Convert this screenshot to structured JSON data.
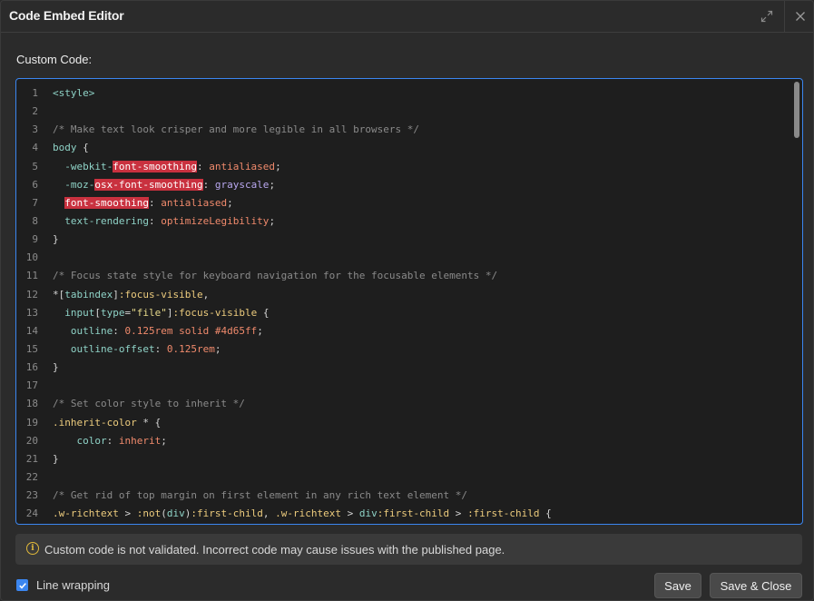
{
  "dialog": {
    "title": "Code Embed Editor",
    "expand_icon": "expand-arrows-icon",
    "close_icon": "close-icon"
  },
  "field": {
    "label": "Custom Code:"
  },
  "editor": {
    "lines": [
      {
        "n": "1",
        "tokens": [
          {
            "t": "tag",
            "v": "<style>"
          }
        ]
      },
      {
        "n": "2",
        "tokens": []
      },
      {
        "n": "3",
        "tokens": [
          {
            "t": "comment",
            "v": "/* Make text look crisper and more legible in all browsers */"
          }
        ]
      },
      {
        "n": "4",
        "tokens": [
          {
            "t": "tag",
            "v": "body"
          },
          {
            "t": "punc",
            "v": " {"
          }
        ]
      },
      {
        "n": "5",
        "tokens": [
          {
            "t": "prop",
            "v": "  -webkit-"
          },
          {
            "t": "err",
            "v": "font-smoothing"
          },
          {
            "t": "punc",
            "v": ": "
          },
          {
            "t": "val",
            "v": "antialiased"
          },
          {
            "t": "punc",
            "v": ";"
          }
        ]
      },
      {
        "n": "6",
        "tokens": [
          {
            "t": "prop",
            "v": "  -moz-"
          },
          {
            "t": "err",
            "v": "osx-font-smoothing"
          },
          {
            "t": "punc",
            "v": ": "
          },
          {
            "t": "kw",
            "v": "grayscale"
          },
          {
            "t": "punc",
            "v": ";"
          }
        ]
      },
      {
        "n": "7",
        "tokens": [
          {
            "t": "punc",
            "v": "  "
          },
          {
            "t": "err",
            "v": "font-smoothing"
          },
          {
            "t": "punc",
            "v": ": "
          },
          {
            "t": "val",
            "v": "antialiased"
          },
          {
            "t": "punc",
            "v": ";"
          }
        ]
      },
      {
        "n": "8",
        "tokens": [
          {
            "t": "prop",
            "v": "  text-rendering"
          },
          {
            "t": "punc",
            "v": ": "
          },
          {
            "t": "val",
            "v": "optimizeLegibility"
          },
          {
            "t": "punc",
            "v": ";"
          }
        ]
      },
      {
        "n": "9",
        "tokens": [
          {
            "t": "punc",
            "v": "}"
          }
        ]
      },
      {
        "n": "10",
        "tokens": []
      },
      {
        "n": "11",
        "tokens": [
          {
            "t": "comment",
            "v": "/* Focus state style for keyboard navigation for the focusable elements */"
          }
        ]
      },
      {
        "n": "12",
        "tokens": [
          {
            "t": "punc",
            "v": "*["
          },
          {
            "t": "prop",
            "v": "tabindex"
          },
          {
            "t": "punc",
            "v": "]"
          },
          {
            "t": "sel",
            "v": ":focus-visible"
          },
          {
            "t": "punc",
            "v": ","
          }
        ]
      },
      {
        "n": "13",
        "tokens": [
          {
            "t": "tag",
            "v": "  input"
          },
          {
            "t": "punc",
            "v": "["
          },
          {
            "t": "prop",
            "v": "type"
          },
          {
            "t": "punc",
            "v": "="
          },
          {
            "t": "str",
            "v": "\"file\""
          },
          {
            "t": "punc",
            "v": "]"
          },
          {
            "t": "sel",
            "v": ":focus-visible"
          },
          {
            "t": "punc",
            "v": " {"
          }
        ]
      },
      {
        "n": "14",
        "tokens": [
          {
            "t": "prop",
            "v": "   outline"
          },
          {
            "t": "punc",
            "v": ": "
          },
          {
            "t": "num",
            "v": "0.125rem"
          },
          {
            "t": "val",
            "v": " solid #4d65ff"
          },
          {
            "t": "punc",
            "v": ";"
          }
        ]
      },
      {
        "n": "15",
        "tokens": [
          {
            "t": "prop",
            "v": "   outline-offset"
          },
          {
            "t": "punc",
            "v": ": "
          },
          {
            "t": "num",
            "v": "0.125rem"
          },
          {
            "t": "punc",
            "v": ";"
          }
        ]
      },
      {
        "n": "16",
        "tokens": [
          {
            "t": "punc",
            "v": "}"
          }
        ]
      },
      {
        "n": "17",
        "tokens": []
      },
      {
        "n": "18",
        "tokens": [
          {
            "t": "comment",
            "v": "/* Set color style to inherit */"
          }
        ]
      },
      {
        "n": "19",
        "tokens": [
          {
            "t": "sel",
            "v": ".inherit-color"
          },
          {
            "t": "punc",
            "v": " * {"
          }
        ]
      },
      {
        "n": "20",
        "tokens": [
          {
            "t": "prop",
            "v": "    color"
          },
          {
            "t": "punc",
            "v": ": "
          },
          {
            "t": "val",
            "v": "inherit"
          },
          {
            "t": "punc",
            "v": ";"
          }
        ]
      },
      {
        "n": "21",
        "tokens": [
          {
            "t": "punc",
            "v": "}"
          }
        ]
      },
      {
        "n": "22",
        "tokens": []
      },
      {
        "n": "23",
        "tokens": [
          {
            "t": "comment",
            "v": "/* Get rid of top margin on first element in any rich text element */"
          }
        ]
      },
      {
        "n": "24",
        "tokens": [
          {
            "t": "sel",
            "v": ".w-richtext"
          },
          {
            "t": "punc",
            "v": " > "
          },
          {
            "t": "sel",
            "v": ":not"
          },
          {
            "t": "punc",
            "v": "("
          },
          {
            "t": "tag",
            "v": "div"
          },
          {
            "t": "punc",
            "v": ")"
          },
          {
            "t": "sel",
            "v": ":first-child"
          },
          {
            "t": "punc",
            "v": ", "
          },
          {
            "t": "sel",
            "v": ".w-richtext"
          },
          {
            "t": "punc",
            "v": " > "
          },
          {
            "t": "tag",
            "v": "div"
          },
          {
            "t": "sel",
            "v": ":first-child"
          },
          {
            "t": "punc",
            "v": " > "
          },
          {
            "t": "sel",
            "v": ":first-child"
          },
          {
            "t": "punc",
            "v": " {"
          }
        ]
      }
    ]
  },
  "notice": {
    "icon": "info-icon",
    "icon_glyph": "i",
    "text": "Custom code is not validated. Incorrect code may cause issues with the published page."
  },
  "footer": {
    "wrap_label": "Line wrapping",
    "wrap_checked": true,
    "save_label": "Save",
    "save_close_label": "Save & Close"
  },
  "colors": {
    "accent": "#3b86f0",
    "error_highlight": "#c9313f",
    "warning": "#e0b93a"
  }
}
